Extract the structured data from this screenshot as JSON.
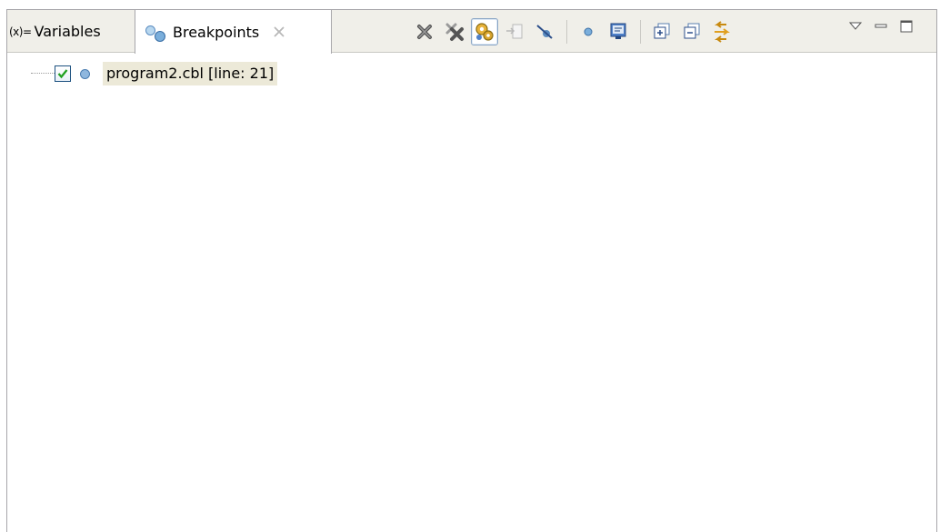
{
  "tabs": {
    "variables": {
      "icon": "variables-icon",
      "icon_text": "(x)=",
      "label": "Variables"
    },
    "breakpoints": {
      "icon": "breakpoints-icon",
      "label": "Breakpoints",
      "close_icon": "close-icon",
      "active": true
    }
  },
  "toolbar": {
    "buttons": [
      {
        "name": "remove-selected-breakpoints",
        "icon": "remove-x-icon"
      },
      {
        "name": "remove-all-breakpoints",
        "icon": "remove-all-x-icon"
      },
      {
        "name": "show-breakpoints-supported-by-selected-target",
        "icon": "gears-icon",
        "pressed": true
      },
      {
        "name": "go-to-file-for-breakpoint",
        "icon": "go-to-file-icon",
        "disabled": true
      },
      {
        "name": "skip-all-breakpoints",
        "icon": "skip-breakpoints-icon"
      },
      {
        "name": "add-breakpoint",
        "icon": "breakpoint-dot-icon"
      },
      {
        "name": "open-breakpoint-in-editor",
        "icon": "monitor-icon"
      },
      {
        "name": "expand-all",
        "icon": "expand-all-icon"
      },
      {
        "name": "collapse-all",
        "icon": "collapse-all-icon"
      },
      {
        "name": "link-with-debug-view",
        "icon": "link-arrows-icon"
      }
    ],
    "view_menu": [
      {
        "name": "view-menu",
        "icon": "triangle-down-icon"
      },
      {
        "name": "minimize",
        "icon": "minimize-icon"
      },
      {
        "name": "maximize",
        "icon": "maximize-icon"
      }
    ]
  },
  "breakpoints": [
    {
      "label": "program2.cbl [line: 21]",
      "checked": true,
      "icon": "breakpoint-dot-icon"
    }
  ],
  "colors": {
    "tab_bar_bg": "#f0efe9",
    "selection_bg": "#ece9d8",
    "border": "#a7a6aa"
  }
}
